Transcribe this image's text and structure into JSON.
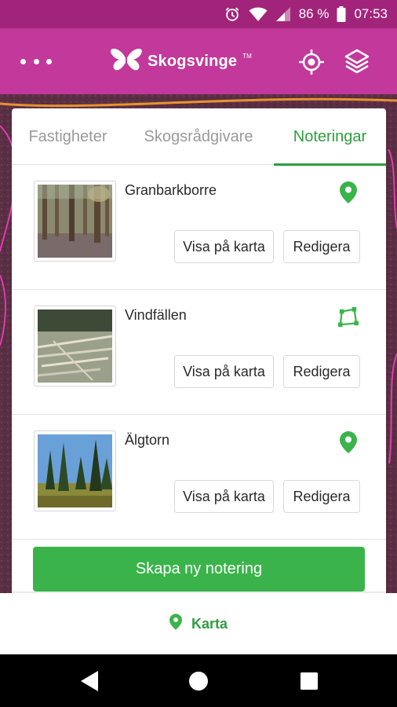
{
  "status_bar": {
    "battery_percent": "86 %",
    "time": "07:53"
  },
  "app_bar": {
    "logo_text": "Skogsvinge",
    "logo_tm": "TM",
    "icons": [
      "more-dots-icon",
      "location-crosshair-icon",
      "layers-icon"
    ]
  },
  "tabs": [
    {
      "label": "Fastigheter",
      "active": false
    },
    {
      "label": "Skogsrådgivare",
      "active": false
    },
    {
      "label": "Noteringar",
      "active": true
    }
  ],
  "notes": [
    {
      "title": "Granbarkborre",
      "type_icon": "map-pin-icon",
      "show_label": "Visa på karta",
      "edit_label": "Redigera"
    },
    {
      "title": "Vindfällen",
      "type_icon": "polygon-area-icon",
      "show_label": "Visa på karta",
      "edit_label": "Redigera"
    },
    {
      "title": "Älgtorn",
      "type_icon": "map-pin-icon",
      "show_label": "Visa på karta",
      "edit_label": "Redigera"
    }
  ],
  "create_button_label": "Skapa ny notering",
  "bottom_bar": {
    "label": "Karta",
    "icon": "map-pin-icon"
  },
  "colors": {
    "status_bar": "#a2247a",
    "app_bar": "#c2399b",
    "accent_green": "#3ab44a",
    "active_tab_green": "#2e9e3f"
  }
}
